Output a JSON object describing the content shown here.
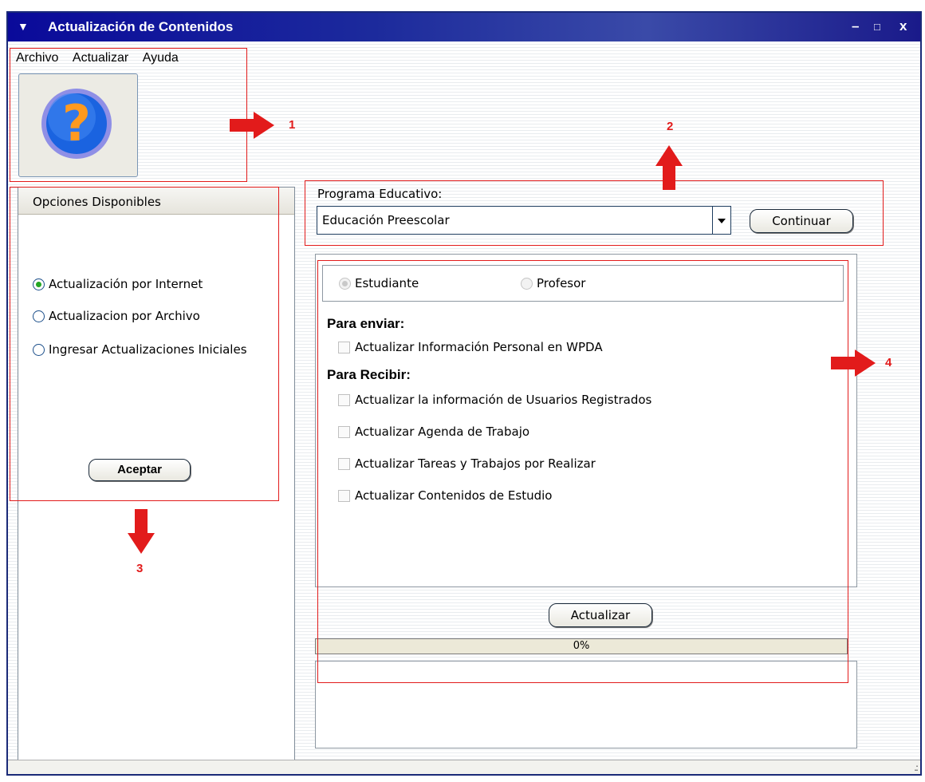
{
  "window": {
    "title": "Actualización de Contenidos",
    "controls": {
      "minimize": "–",
      "maximize": "□",
      "close": "x"
    }
  },
  "menu": [
    "Archivo",
    "Actualizar",
    "Ayuda"
  ],
  "toolbar": {
    "help_icon": "question-mark-icon"
  },
  "left_panel": {
    "header": "Opciones Disponibles",
    "options": [
      {
        "label": "Actualización por Internet",
        "selected": true
      },
      {
        "label": "Actualizacion por Archivo",
        "selected": false
      },
      {
        "label": "Ingresar Actualizaciones Iniciales",
        "selected": false
      }
    ],
    "accept_button": "Aceptar"
  },
  "program": {
    "label": "Programa Educativo:",
    "selected": "Educación Preescolar",
    "continue_button": "Continuar"
  },
  "roles": [
    {
      "label": "Estudiante",
      "selected": true
    },
    {
      "label": "Profesor",
      "selected": false
    }
  ],
  "send": {
    "heading": "Para enviar:",
    "items": [
      "Actualizar Información Personal en WPDA"
    ]
  },
  "receive": {
    "heading": "Para Recibir:",
    "items": [
      "Actualizar la información de Usuarios Registrados",
      "Actualizar Agenda de Trabajo",
      "Actualizar Tareas y Trabajos por Realizar",
      "Actualizar Contenidos de Estudio"
    ]
  },
  "update_button": "Actualizar",
  "progress": {
    "value": 0,
    "label": "0%"
  },
  "annotations": [
    "1",
    "2",
    "3",
    "4"
  ],
  "colors": {
    "title_bar": "#0a0a9a",
    "annotation": "#e21b1b",
    "radio_selected": "#24a624"
  }
}
